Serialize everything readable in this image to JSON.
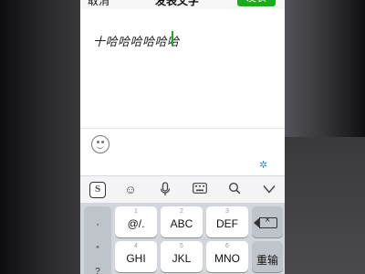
{
  "nav": {
    "cancel_label": "取消",
    "title": "发表文字",
    "publish_label": "发表"
  },
  "editor": {
    "text": "十哈哈哈哈哈哈"
  },
  "assist_bar": {
    "icon": "snowflake-icon"
  },
  "toolbar": {
    "sogou_label": "S",
    "icons": [
      "sogou-icon",
      "smile-icon",
      "microphone-icon",
      "keyboard-icon",
      "search-icon",
      "collapse-icon"
    ]
  },
  "keyboard": {
    "side_column": [
      ",",
      "“",
      "?"
    ],
    "rows": [
      [
        {
          "num": "1",
          "label": "@/."
        },
        {
          "num": "2",
          "label": "ABC"
        },
        {
          "num": "3",
          "label": "DEF"
        }
      ],
      [
        {
          "num": "4",
          "label": "GHI"
        },
        {
          "num": "5",
          "label": "JKL"
        },
        {
          "num": "6",
          "label": "MNO"
        }
      ]
    ],
    "delete_icon": "backspace-icon",
    "enter_label": "重输"
  },
  "colors": {
    "accent_green": "#1aad19",
    "assist_blue": "#2f8fe0",
    "keyboard_bg": "#d2d5db"
  }
}
